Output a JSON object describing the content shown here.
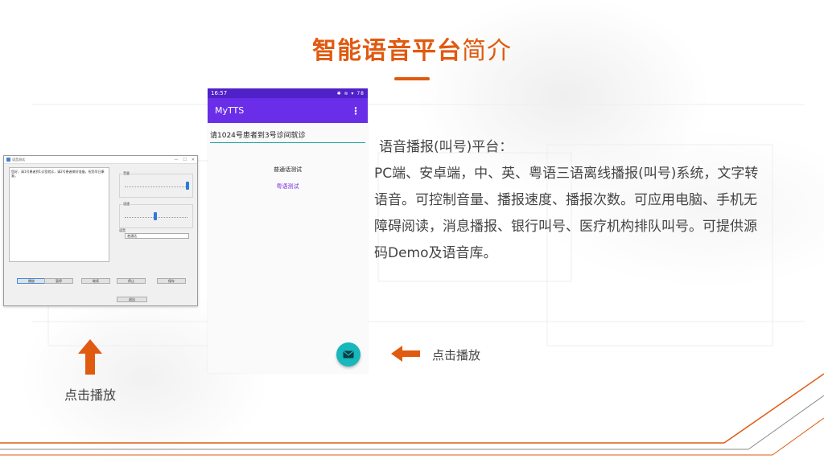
{
  "title": {
    "bold": "智能语音平台",
    "light": "简介"
  },
  "desktop_app": {
    "window_title": "语音测试",
    "window_controls": [
      "—",
      "☐",
      "✕"
    ],
    "textarea_text": "您好，请1号患者到1诊室就诊，请2号患者做好准备。祝您早日康复。",
    "volume_label": "音量",
    "speed_label": "语速",
    "voice_label": "语音",
    "voice_selected": "普通话",
    "buttons": [
      "播放",
      "暂停",
      "继续",
      "停止",
      "保存"
    ],
    "bottom_button": "退出"
  },
  "phone_app": {
    "status_time": "16:57",
    "status_icons": "✱ ≋ ▾ 78",
    "app_name": "MyTTS",
    "menu_icon": "⋮",
    "input_text": "请1024号患者到3号诊间就诊",
    "mandarin_test": "普通话测试",
    "cantonese_test": "粤语测试",
    "fab_icon": "mail-icon"
  },
  "description": {
    "heading": " 语音播报(叫号)平台：",
    "body": "PC端、安卓端，中、英、粤语三语离线播报(叫号)系统，文字转语音。可控制音量、播报速度、播报次数。可应用电脑、手机无障碍阅读，消息播报、银行叫号、医疗机构排队叫号。可提供源码Demo及语音库。"
  },
  "labels": {
    "click_play_left": "点击播放",
    "click_play_right": "点击播放"
  },
  "colors": {
    "accent": "#E05A10",
    "phone_statusbar": "#5020c8",
    "phone_appbar": "#6a2ee8",
    "fab": "#17b7bb"
  }
}
